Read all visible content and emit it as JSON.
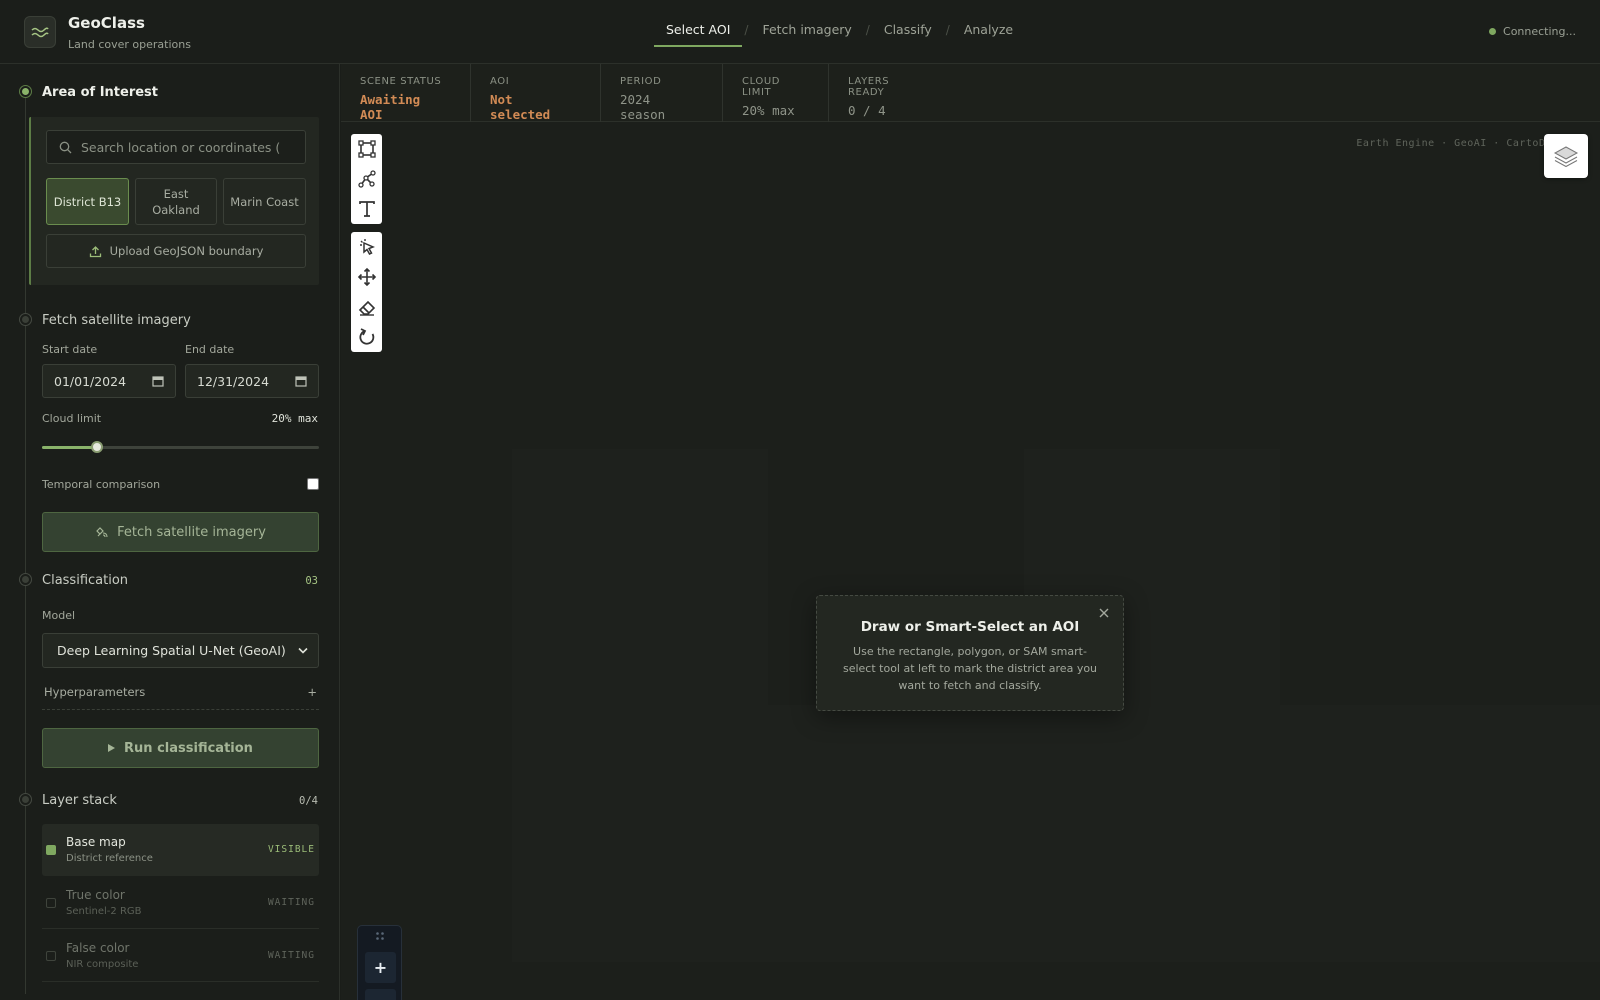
{
  "app": {
    "title": "GeoClass",
    "subtitle": "Land cover operations",
    "connection": "Connecting..."
  },
  "steps": [
    {
      "label": "Select AOI",
      "active": true
    },
    {
      "label": "Fetch imagery",
      "active": false
    },
    {
      "label": "Classify",
      "active": false
    },
    {
      "label": "Analyze",
      "active": false
    }
  ],
  "sidebar": {
    "aoi": {
      "title": "Area of Interest",
      "search_placeholder": "Search location or coordinates (lat,",
      "presets": [
        "District B13",
        "East Oakland",
        "Marin Coast"
      ],
      "upload_label": "Upload GeoJSON boundary"
    },
    "fetch": {
      "title": "Fetch satellite imagery",
      "start_label": "Start date",
      "start_value": "01/01/2024",
      "end_label": "End date",
      "end_value": "12/31/2024",
      "cloud_label": "Cloud limit",
      "cloud_value": "20% max",
      "cloud_fraction": 0.2,
      "temporal_label": "Temporal comparison",
      "temporal_checked": false,
      "button_label": "Fetch satellite imagery"
    },
    "classification": {
      "title": "Classification",
      "count": "03",
      "model_label": "Model",
      "model_value": "Deep Learning Spatial U-Net (GeoAI)",
      "hyper_label": "Hyperparameters",
      "hyper_icon": "+",
      "button_label": "Run classification"
    },
    "layers": {
      "title": "Layer stack",
      "count": "0/4",
      "items": [
        {
          "name": "Base map",
          "desc": "District reference",
          "status": "VISIBLE",
          "on": true
        },
        {
          "name": "True color",
          "desc": "Sentinel-2 RGB",
          "status": "WAITING",
          "on": false
        },
        {
          "name": "False color",
          "desc": "NIR composite",
          "status": "WAITING",
          "on": false
        }
      ]
    }
  },
  "status": [
    {
      "label": "SCENE STATUS",
      "value": "Awaiting AOI",
      "highlight": true
    },
    {
      "label": "AOI",
      "value": "Not selected",
      "highlight": true
    },
    {
      "label": "PERIOD",
      "value": "2024 season",
      "highlight": false
    },
    {
      "label": "CLOUD LIMIT",
      "value": "20% max",
      "highlight": false
    },
    {
      "label": "LAYERS READY",
      "value": "0 / 4",
      "highlight": false
    }
  ],
  "map": {
    "attribution": "Earth Engine · GeoAI · CartoDB",
    "modal_title": "Draw or Smart-Select an AOI",
    "modal_body": "Use the rectangle, polygon, or SAM smart-select tool at left to mark the district area you want to fetch and classify.",
    "zoom_in": "+"
  },
  "colors": {
    "accent": "#7fa860",
    "warning": "#d28b55",
    "background": "#1a1d19"
  }
}
